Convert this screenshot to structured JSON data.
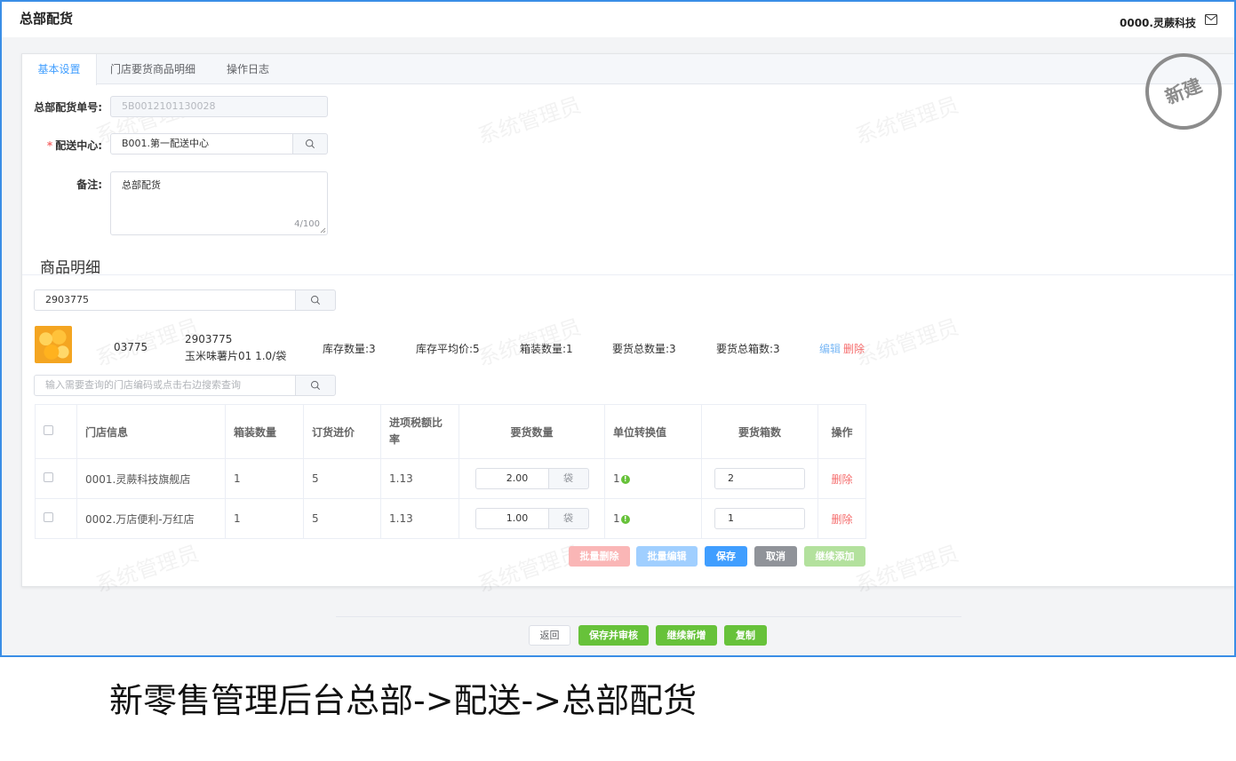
{
  "header": {
    "title": "总部配货",
    "user": "0000.灵蕨科技"
  },
  "tabs": [
    {
      "label": "基本设置",
      "active": true
    },
    {
      "label": "门店要货商品明细",
      "active": false
    },
    {
      "label": "操作日志",
      "active": false
    }
  ],
  "form": {
    "order_no_label": "总部配货单号:",
    "order_no_value": "5B0012101130028",
    "center_label": "配送中心:",
    "center_value": "B001.第一配送中心",
    "remark_label": "备注:",
    "remark_value": "总部配货",
    "remark_counter": "4/100"
  },
  "stamp": "新建",
  "watermark": "系统管理员",
  "details": {
    "section_title": "商品明细",
    "product_search_value": "2903775",
    "store_search_placeholder": "输入需要查询的门店编码或点击右边搜索查询"
  },
  "product": {
    "short_code": "03775",
    "code": "2903775",
    "name": "玉米味薯片01 1.0/袋",
    "stock_qty": "库存数量:3",
    "avg_price": "库存平均价:5",
    "pack_qty": "箱装数量:1",
    "total_qty": "要货总数量:3",
    "total_boxes": "要货总箱数:3",
    "edit": "编辑",
    "delete": "删除"
  },
  "table": {
    "headers": [
      "门店信息",
      "箱装数量",
      "订货进价",
      "进项税额比率",
      "要货数量",
      "单位转换值",
      "要货箱数",
      "操作"
    ],
    "rows": [
      {
        "store": "0001.灵蕨科技旗舰店",
        "pack": "1",
        "price": "5",
        "tax": "1.13",
        "qty": "2.00",
        "unit": "袋",
        "conv": "1",
        "boxes": "2",
        "action": "删除"
      },
      {
        "store": "0002.万店便利-万红店",
        "pack": "1",
        "price": "5",
        "tax": "1.13",
        "qty": "1.00",
        "unit": "袋",
        "conv": "1",
        "boxes": "1",
        "action": "删除"
      }
    ]
  },
  "batch_buttons": {
    "batch_delete": "批量删除",
    "batch_edit": "批量编辑",
    "save": "保存",
    "cancel": "取消",
    "continue_add": "继续添加"
  },
  "footer_buttons": {
    "back": "返回",
    "save_audit": "保存并审核",
    "continue_new": "继续新增",
    "copy": "复制"
  },
  "caption": "新零售管理后台总部->配送->总部配货",
  "colors": {
    "primary": "#409eff",
    "success": "#67c23a",
    "danger": "#f56c6c",
    "frame": "#3a8ee6"
  }
}
